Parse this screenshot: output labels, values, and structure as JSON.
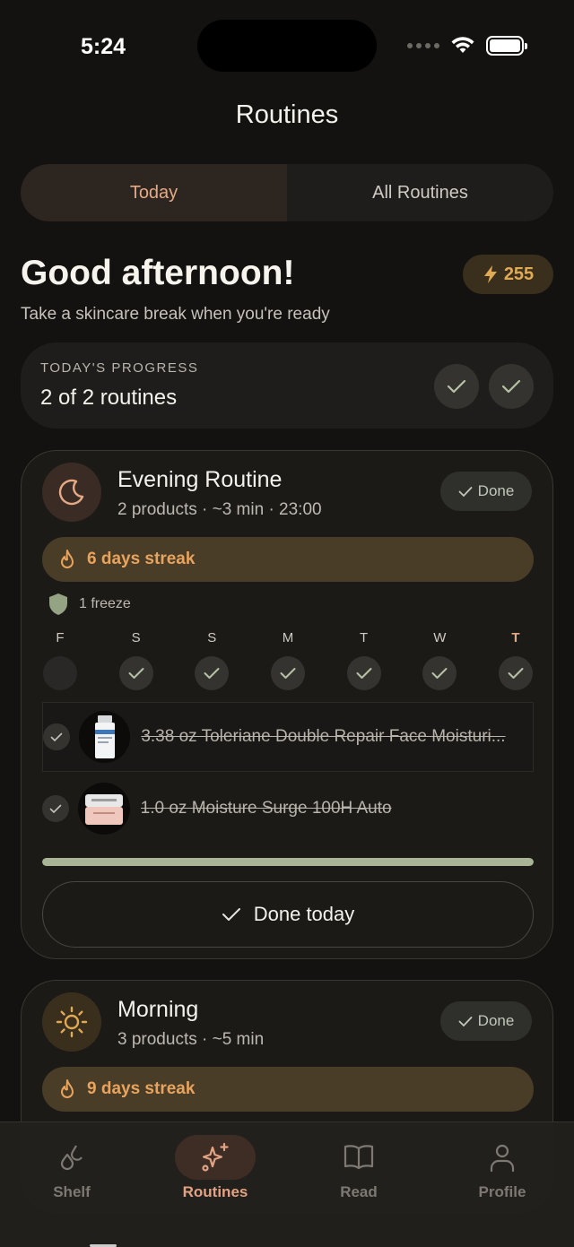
{
  "status": {
    "time": "5:24"
  },
  "header": {
    "title": "Routines"
  },
  "segments": {
    "today": "Today",
    "all": "All Routines"
  },
  "greeting": {
    "title": "Good afternoon!",
    "subtitle": "Take a skincare break when you're ready",
    "points": "255"
  },
  "progress": {
    "label": "TODAY'S PROGRESS",
    "value": "2 of 2 routines",
    "completed": 2,
    "total": 2
  },
  "evening": {
    "title": "Evening Routine",
    "meta": "2 products · ~3 min · 23:00",
    "status": "Done",
    "streak": "6 days streak",
    "freeze": "1 freeze",
    "days": [
      {
        "label": "F",
        "checked": false,
        "today": false
      },
      {
        "label": "S",
        "checked": true,
        "today": false
      },
      {
        "label": "S",
        "checked": true,
        "today": false
      },
      {
        "label": "M",
        "checked": true,
        "today": false
      },
      {
        "label": "T",
        "checked": true,
        "today": false
      },
      {
        "label": "W",
        "checked": true,
        "today": false
      },
      {
        "label": "T",
        "checked": true,
        "today": true
      }
    ],
    "products": [
      {
        "name": "3.38 oz Toleriane Double Repair Face Moisturi...",
        "done": true
      },
      {
        "name": "1.0 oz Moisture Surge 100H Auto",
        "done": true
      }
    ],
    "completion": 1.0,
    "done_button": "Done today"
  },
  "morning": {
    "title": "Morning",
    "meta": "3 products · ~5 min",
    "status": "Done",
    "streak": "9 days streak"
  },
  "tabbar": {
    "items": [
      {
        "label": "Shelf",
        "icon": "drops-icon",
        "active": false
      },
      {
        "label": "Routines",
        "icon": "sparkles-icon",
        "active": true
      },
      {
        "label": "Read",
        "icon": "book-icon",
        "active": false
      },
      {
        "label": "Profile",
        "icon": "person-icon",
        "active": false
      }
    ]
  },
  "colors": {
    "accent": "#e5a985",
    "streak": "#e8a45e",
    "progress": "#a7b596",
    "background": "#141210"
  }
}
